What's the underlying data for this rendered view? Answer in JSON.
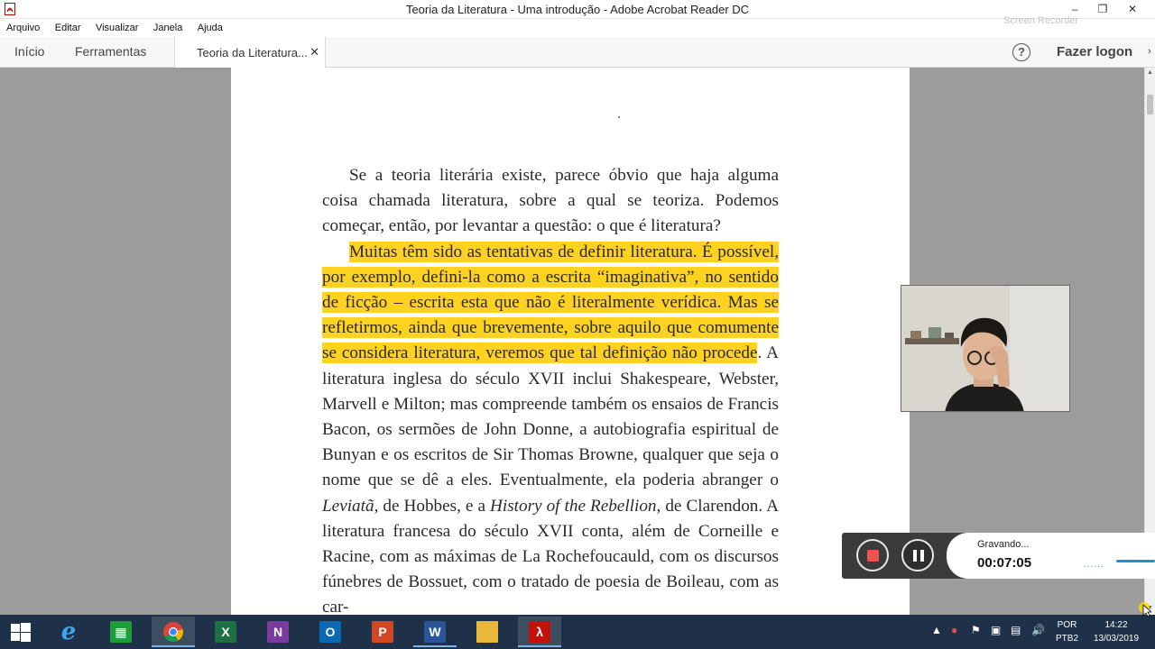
{
  "window": {
    "title": "Teoria da Literatura - Uma introdução - Adobe Acrobat Reader DC"
  },
  "menu": [
    "Arquivo",
    "Editar",
    "Visualizar",
    "Janela",
    "Ajuda"
  ],
  "toolbar": {
    "home_tab": "Início",
    "tools_tab": "Ferramentas",
    "doc_tab": "Teoria da Literatura...",
    "help_icon": "?",
    "login": "Fazer logon"
  },
  "document": {
    "p1": "Se a teoria literária existe, parece óbvio que haja alguma coisa chamada literatura, sobre a qual se teoriza. Podemos começar, então, por levantar a questão: o que é literatura?",
    "p2_highlight": "Muitas têm sido as tentativas de definir literatura. É possível, por exemplo, defini-la como a escrita “imaginativa”, no sentido de ficção – escrita esta que não é literalmente verídica. Mas se refletirmos, ainda que brevemente, sobre aquilo que comumente se considera literatura, veremos que tal definição não procede",
    "p2_a": ". A literatura inglesa do século XVII inclui Shakespeare, Webster, Marvell e Milton; mas compreende também os ensaios de Francis Bacon, os sermões de John Donne, a autobiografia espiritual de Bunyan e os escritos de Sir Thomas Browne, qualquer que seja o nome que se dê a eles. Eventualmente, ela poderia abranger o ",
    "p2_i1": "Leviatã",
    "p2_b": ", de Hobbes, e a ",
    "p2_i2": "History of the Rebellion",
    "p2_c": ", de Clarendon. A literatura francesa do século XVII conta, além de Corneille e Racine, com as máximas de La Rochefoucauld, com os discursos fúnebres de Bossuet, com o tratado de poesia de Boileau, com as car-",
    "highlight_color": "#ffd21f"
  },
  "recorder": {
    "status": "Gravando...",
    "elapsed": "00:07:05",
    "level_dots": "......",
    "stop_color": "#ef5350"
  },
  "watermark": "Screen Recorder",
  "taskbar": {
    "apps": [
      "start-icon",
      "internet-explorer-icon",
      "store-icon",
      "chrome-icon",
      "excel-icon",
      "onenote-icon",
      "outlook-icon",
      "powerpoint-icon",
      "word-icon",
      "file-explorer-icon",
      "acrobat-icon"
    ],
    "lang_1": "POR",
    "lang_2": "PTB2",
    "time": "14:22",
    "date": "13/03/2019"
  }
}
